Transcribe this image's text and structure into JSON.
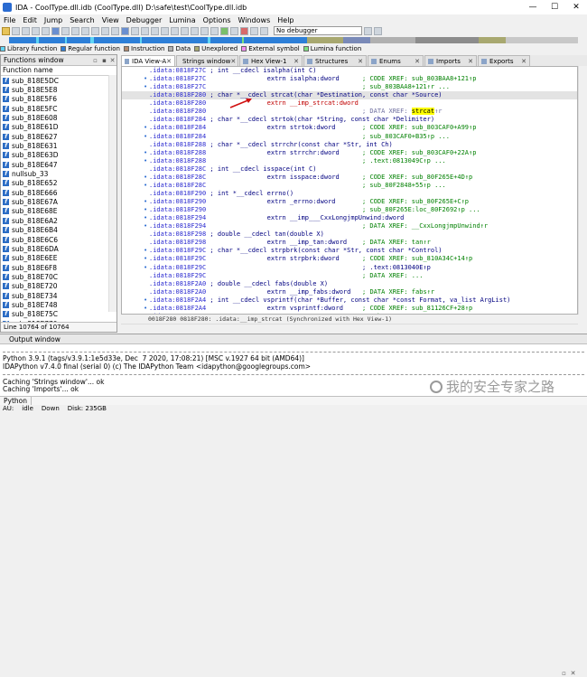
{
  "window": {
    "title": "IDA - CoolType.dll.idb (CoolType.dll) D:\\safe\\test\\CoolType.dll.idb",
    "minimize": "—",
    "maximize": "☐",
    "close": "✕"
  },
  "menu": [
    "File",
    "Edit",
    "Jump",
    "Search",
    "View",
    "Debugger",
    "Lumina",
    "Options",
    "Windows",
    "Help"
  ],
  "toolbar": {
    "debugger_value": "No debugger"
  },
  "legend": [
    {
      "label": "Library function",
      "color": "#5fd5f5"
    },
    {
      "label": "Regular function",
      "color": "#2d7fd8"
    },
    {
      "label": "Instruction",
      "color": "#b38a6e"
    },
    {
      "label": "Data",
      "color": "#b0b0b0"
    },
    {
      "label": "Unexplored",
      "color": "#a8a870"
    },
    {
      "label": "External symbol",
      "color": "#f28bf2"
    },
    {
      "label": "Lumina function",
      "color": "#7ee07e"
    }
  ],
  "functions_window": {
    "title": "Functions window",
    "header": "Function name",
    "items": [
      "sub_818E5DC",
      "sub_818E5E8",
      "sub_818E5F6",
      "sub_818E5FC",
      "sub_818E608",
      "sub_818E61D",
      "sub_818E627",
      "sub_818E631",
      "sub_818E63D",
      "sub_818E647",
      "nullsub_33",
      "sub_818E652",
      "sub_818E666",
      "sub_818E67A",
      "sub_818E68E",
      "sub_818E6A2",
      "sub_818E6B4",
      "sub_818E6C6",
      "sub_818E6DA",
      "sub_818E6EE",
      "sub_818E6F8",
      "sub_818E70C",
      "sub_818E720",
      "sub_818E734",
      "sub_818E748",
      "sub_818E75C",
      "sub_818E770"
    ],
    "status": "Line 10764 of 10764"
  },
  "tabs": [
    {
      "label": "IDA View-A",
      "active": true
    },
    {
      "label": "Strings window",
      "active": false
    },
    {
      "label": "Hex View-1",
      "active": false
    },
    {
      "label": "Structures",
      "active": false
    },
    {
      "label": "Enums",
      "active": false
    },
    {
      "label": "Imports",
      "active": false
    },
    {
      "label": "Exports",
      "active": false
    }
  ],
  "disasm": [
    {
      "addr": ".idata:0818F27C",
      "text": " ; int __cdecl isalpha(int C)",
      "cls": "cmt"
    },
    {
      "addr": ".idata:0818F27C",
      "text": "                extrn isalpha:dword      ; CODE XREF: sub_803BAA8+121↑p",
      "bullet": true
    },
    {
      "addr": ".idata:0818F27C",
      "text": "                                         ; sub_803BAA8+121↑r ...",
      "bullet": true
    },
    {
      "addr": ".idata:0818F280",
      "text": " ; char *__cdecl strcat(char *Destination, const char *Source)",
      "hl": true
    },
    {
      "addr": ".idata:0818F280",
      "text": "                extrn __imp_strcat:dword",
      "special": "strcat_imp"
    },
    {
      "addr": ".idata:0818F280",
      "text": "                                         ; DATA XREF: strcat↑r",
      "special": "xref"
    },
    {
      "addr": ".idata:0818F284",
      "text": " ; char *__cdecl strtok(char *String, const char *Delimiter)"
    },
    {
      "addr": ".idata:0818F284",
      "text": "                extrn strtok:dword       ; CODE XREF: sub_803CAF0+A99↑p",
      "bullet": true
    },
    {
      "addr": ".idata:0818F284",
      "text": "                                         ; sub_803CAF0+B35↑p ...",
      "bullet": true
    },
    {
      "addr": ".idata:0818F288",
      "text": " ; char *__cdecl strrchr(const char *Str, int Ch)"
    },
    {
      "addr": ".idata:0818F288",
      "text": "                extrn strrchr:dword      ; CODE XREF: sub_803CAF0+22A↑p",
      "bullet": true
    },
    {
      "addr": ".idata:0818F288",
      "text": "                                         ; .text:0813049C↑p ...",
      "bullet": true
    },
    {
      "addr": ".idata:0818F28C",
      "text": " ; int __cdecl isspace(int C)"
    },
    {
      "addr": ".idata:0818F28C",
      "text": "                extrn isspace:dword      ; CODE XREF: sub_80F265E+4D↑p",
      "bullet": true
    },
    {
      "addr": ".idata:0818F28C",
      "text": "                                         ; sub_80F2848+55↑p ...",
      "bullet": true
    },
    {
      "addr": ".idata:0818F290",
      "text": " ; int *__cdecl errno()"
    },
    {
      "addr": ".idata:0818F290",
      "text": "                extrn _errno:dword       ; CODE XREF: sub_80F265E+C↑p",
      "bullet": true
    },
    {
      "addr": ".idata:0818F290",
      "text": "                                         ; sub_80F265E:loc_80F2692↑p ...",
      "bullet": true
    },
    {
      "addr": ".idata:0818F294",
      "text": "                extrn __imp___CxxLongjmpUnwind:dword",
      "bullet": true
    },
    {
      "addr": ".idata:0818F294",
      "text": "                                         ; DATA XREF: __CxxLongjmpUnwind↑r",
      "bullet": true
    },
    {
      "addr": ".idata:0818F298",
      "text": " ; double __cdecl tan(double X)"
    },
    {
      "addr": ".idata:0818F298",
      "text": "                extrn __imp_tan:dword    ; DATA XREF: tan↑r"
    },
    {
      "addr": ".idata:0818F29C",
      "text": " ; char *__cdecl strpbrk(const char *Str, const char *Control)",
      "bullet": true
    },
    {
      "addr": ".idata:0818F29C",
      "text": "                extrn strpbrk:dword      ; CODE XREF: sub_810A34C+14↑p",
      "bullet": true
    },
    {
      "addr": ".idata:0818F29C",
      "text": "                                         ; .text:0813040E↑p",
      "bullet": true
    },
    {
      "addr": ".idata:0818F29C",
      "text": "                                         ; DATA XREF: ..."
    },
    {
      "addr": ".idata:0818F2A0",
      "text": " ; double __cdecl fabs(double X)"
    },
    {
      "addr": ".idata:0818F2A0",
      "text": "                extrn __imp_fabs:dword   ; DATA XREF: fabs↑r"
    },
    {
      "addr": ".idata:0818F2A4",
      "text": " ; int __cdecl vsprintf(char *Buffer, const char *const Format, va_list ArgList)",
      "bullet": true
    },
    {
      "addr": ".idata:0818F2A4",
      "text": "                extrn vsprintf:dword     ; CODE XREF: sub_81126CF+28↑p",
      "bullet": true
    },
    {
      "addr": ".idata:0818F2A4",
      "text": "                                         ; sub_81126CF+25↑p ...",
      "bullet": true
    },
    {
      "addr": ".idata:0818F2A8",
      "text": " ; double __cdecl strtod(const char *String, char **EndPtr)",
      "bullet": true
    }
  ],
  "disasm_status": "0018F280 0818F280: .idata:__imp_strcat (Synchronized with Hex View-1)",
  "output": {
    "title": "Output window",
    "lines_top": [
      "Python 3.9.1 (tags/v3.9.1:1e5d33e, Dec  7 2020, 17:08:21) [MSC v.1927 64 bit (AMD64)]",
      "IDAPython v7.4.0 final (serial 0) (c) The IDAPython Team <idapython@googlegroups.com>"
    ],
    "lines_bottom": [
      "Caching 'Strings window'... ok",
      "Caching 'Imports'... ok"
    ],
    "python_button": "Python"
  },
  "status": {
    "au": "AU:",
    "state": "idle",
    "direction": "Down",
    "disk": "Disk: 235GB"
  },
  "watermark": "我的安全专家之路"
}
